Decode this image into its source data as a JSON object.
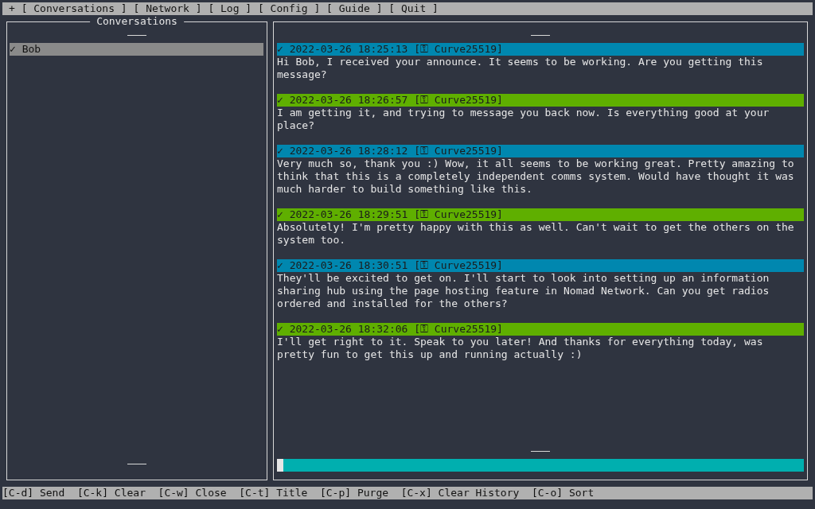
{
  "menu_bar": {
    "items": [
      {
        "label": "+"
      },
      {
        "label": "[ Conversations ]"
      },
      {
        "label": "[ Network ]"
      },
      {
        "label": "[ Log ]"
      },
      {
        "label": "[ Config ]"
      },
      {
        "label": "[ Guide ]"
      },
      {
        "label": "[ Quit ]"
      }
    ]
  },
  "conversations": {
    "title": "Conversations",
    "items": [
      {
        "label": "✓ Bob",
        "selected": true
      }
    ]
  },
  "messages": [
    {
      "header": "✓ 2022-03-26 18:25:13 [⚿ Curve25519]",
      "color": "#0087af",
      "body": "Hi Bob, I received your announce. It seems to be working. Are you getting this message?"
    },
    {
      "header": "✓ 2022-03-26 18:26:57 [⚿ Curve25519]",
      "color": "#5faf00",
      "body": "I am getting it, and trying to message you back now. Is everything good at your place?"
    },
    {
      "header": "✓ 2022-03-26 18:28:12 [⚿ Curve25519]",
      "color": "#0087af",
      "body": "Very much so, thank you :) Wow, it all seems to be working great. Pretty amazing to think that this is a completely independent comms system. Would have thought it was much harder to build something like this."
    },
    {
      "header": "✓ 2022-03-26 18:29:51 [⚿ Curve25519]",
      "color": "#5faf00",
      "body": "Absolutely! I'm pretty happy with this as well. Can't wait to get the others on the system too."
    },
    {
      "header": "✓ 2022-03-26 18:30:51 [⚿ Curve25519]",
      "color": "#0087af",
      "body": "They'll be excited to get on. I'll start to look into setting up an information sharing hub using the page hosting feature in Nomad Network. Can you get radios ordered and installed for the others?"
    },
    {
      "header": "✓ 2022-03-26 18:32:06 [⚿ Curve25519]",
      "color": "#5faf00",
      "body": "I'll get right to it. Speak to you later! And thanks for everything today, was pretty fun to get this up and running actually :)"
    }
  ],
  "shortcuts": [
    {
      "label": "[C-d] Send"
    },
    {
      "label": "[C-k] Clear"
    },
    {
      "label": "[C-w] Close"
    },
    {
      "label": "[C-t] Title"
    },
    {
      "label": "[C-p] Purge"
    },
    {
      "label": "[C-x] Clear History"
    },
    {
      "label": "[C-o] Sort"
    }
  ]
}
